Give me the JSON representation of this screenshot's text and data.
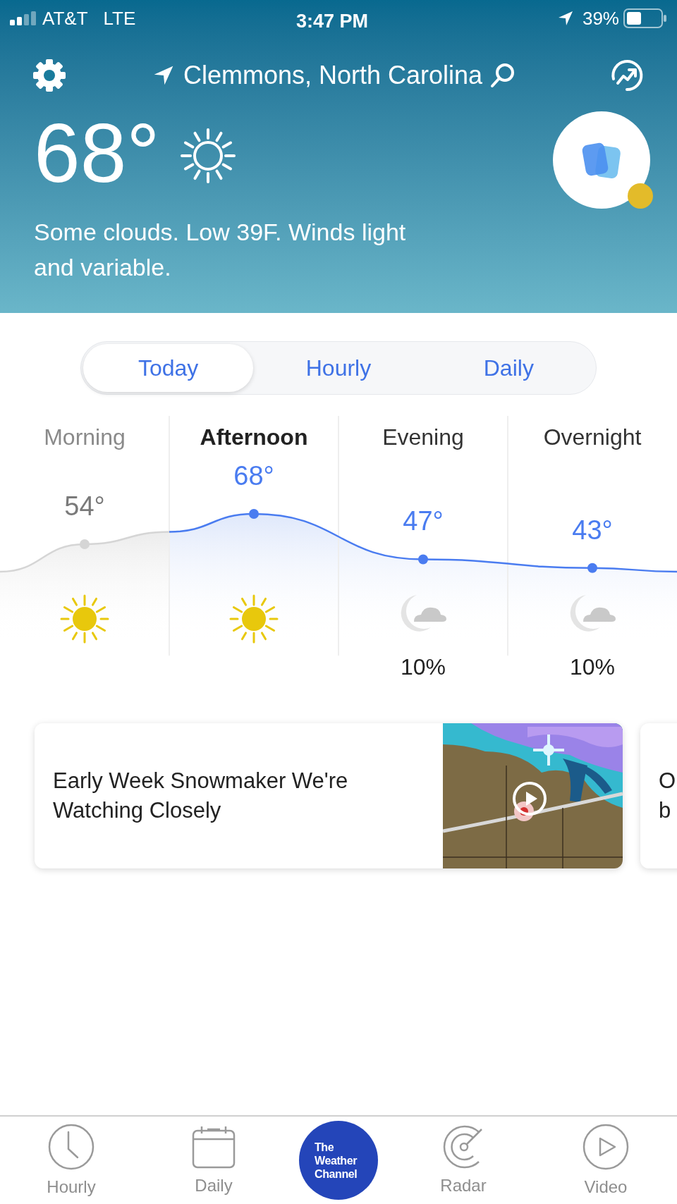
{
  "status_bar": {
    "carrier": "AT&T",
    "network": "LTE",
    "time": "3:47 PM",
    "battery": "39%"
  },
  "header": {
    "location": "Clemmons, North Carolina",
    "temperature": "68°",
    "condition": "Some clouds. Low 39F. Winds light and variable."
  },
  "tabs": [
    {
      "label": "Today",
      "selected": true
    },
    {
      "label": "Hourly",
      "selected": false
    },
    {
      "label": "Daily",
      "selected": false
    }
  ],
  "periods": [
    {
      "name": "Morning",
      "temp": "54°",
      "kind": "sun",
      "past": true,
      "selected": false
    },
    {
      "name": "Afternoon",
      "temp": "68°",
      "kind": "sun",
      "past": false,
      "selected": true
    },
    {
      "name": "Evening",
      "temp": "47°",
      "kind": "moon-cloud",
      "precip": "10%",
      "past": false,
      "selected": false
    },
    {
      "name": "Overnight",
      "temp": "43°",
      "kind": "moon-cloud",
      "precip": "10%",
      "past": false,
      "selected": false
    }
  ],
  "video_cards": [
    {
      "title": "Early Week Snowmaker We're Watching Closely",
      "kind": "picture"
    },
    {
      "title_lines": [
        "O",
        "b"
      ]
    }
  ],
  "bottom_nav": {
    "items": [
      {
        "label": "Hourly",
        "kind": "clock"
      },
      {
        "label": "Daily",
        "kind": "calendar"
      },
      {
        "logo_lines": [
          "The",
          "Weather",
          "Channel"
        ]
      },
      {
        "label": "Radar",
        "kind": "radar"
      },
      {
        "label": "Video",
        "kind": "play"
      }
    ]
  }
}
